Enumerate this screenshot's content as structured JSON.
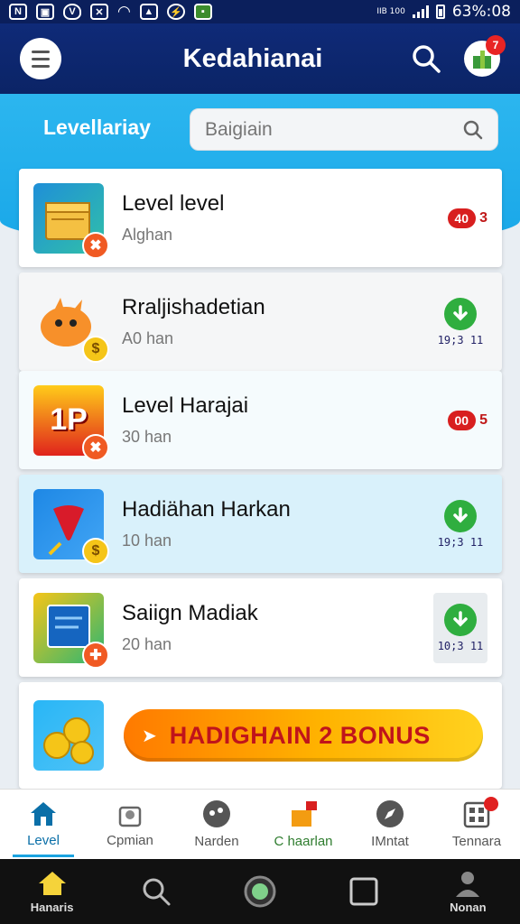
{
  "status_bar": {
    "time_battery": "63%:08",
    "carrier": "IIB 100"
  },
  "app_bar": {
    "title": "Kedahianai",
    "notification_count": "7"
  },
  "filter": {
    "label": "Levellariay",
    "search_placeholder": "Baigiain"
  },
  "items": [
    {
      "title": "Level level",
      "subtitle": "Alghan",
      "action": "pill",
      "pill_value": "40",
      "pill_suffix": "3"
    },
    {
      "title": "Rraljishadetian",
      "subtitle": "A0 han",
      "action": "download",
      "download_text": "19;3 11"
    },
    {
      "title": "Level Harajai",
      "subtitle": "30 han",
      "action": "pill",
      "pill_value": "00",
      "pill_suffix": "5",
      "thumb_text": "1P"
    },
    {
      "title": "Hadiähan Harkan",
      "subtitle": "10 han",
      "action": "download",
      "download_text": "19;3 11"
    },
    {
      "title": "Saiign Madiak",
      "subtitle": "20 han",
      "action": "download",
      "download_text": "10;3 11"
    }
  ],
  "bonus": {
    "label": "HADIGHAIN 2 BONUS"
  },
  "tabs": [
    {
      "label": "Level",
      "icon": "home-icon"
    },
    {
      "label": "Cpmian",
      "icon": "bag-icon"
    },
    {
      "label": "Narden",
      "icon": "dots-icon"
    },
    {
      "label": "C haarlan",
      "icon": "gift-icon"
    },
    {
      "label": "IMntat",
      "icon": "compass-icon"
    },
    {
      "label": "Tennara",
      "icon": "grid-icon"
    }
  ],
  "system_nav": [
    {
      "label": "Hanaris",
      "icon": "home-icon"
    },
    {
      "label": "",
      "icon": "search-icon"
    },
    {
      "label": "",
      "icon": "circle-icon"
    },
    {
      "label": "",
      "icon": "square-icon"
    },
    {
      "label": "Nonan",
      "icon": "person-icon"
    }
  ],
  "colors": {
    "primary": "#0b2466",
    "accent": "#19a7e8",
    "success": "#2fae3f",
    "danger": "#d81f1f"
  }
}
